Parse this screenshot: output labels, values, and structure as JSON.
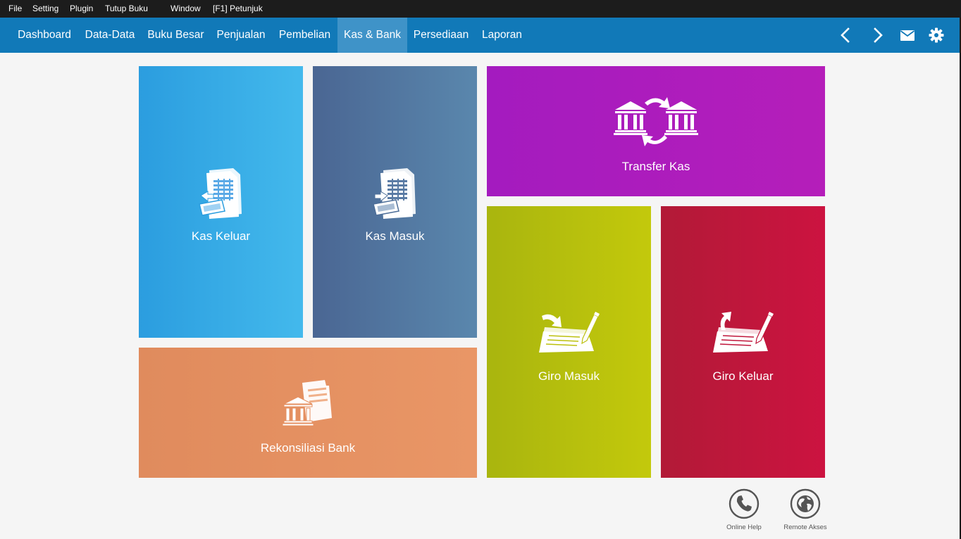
{
  "menubar": {
    "items": [
      "File",
      "Setting",
      "Plugin",
      "Tutup Buku",
      "Window",
      "[F1] Petunjuk"
    ]
  },
  "nav": {
    "tabs": [
      "Dashboard",
      "Data-Data",
      "Buku Besar",
      "Penjualan",
      "Pembelian",
      "Kas & Bank",
      "Persediaan",
      "Laporan"
    ],
    "active_tab": "Kas & Bank",
    "icons": [
      "chevron-left-icon",
      "chevron-right-icon",
      "envelope-icon",
      "gear-icon"
    ]
  },
  "tiles": {
    "kas_keluar": {
      "label": "Kas Keluar",
      "icon": "cash-out-document-icon",
      "color": "#2b9ddf"
    },
    "kas_masuk": {
      "label": "Kas Masuk",
      "icon": "cash-in-document-icon",
      "color": "#4a6693"
    },
    "transfer_kas": {
      "label": "Transfer Kas",
      "icon": "bank-transfer-icon",
      "color": "#b01dbd"
    },
    "giro_masuk": {
      "label": "Giro Masuk",
      "icon": "cheque-in-icon",
      "color": "#b8c00d"
    },
    "giro_keluar": {
      "label": "Giro Keluar",
      "icon": "cheque-out-icon",
      "color": "#c0173c"
    },
    "rekonsiliasi_bank": {
      "label": "Rekonsiliasi Bank",
      "icon": "bank-reconcile-icon",
      "color": "#e58f60"
    }
  },
  "help": {
    "online_help": {
      "label": "Online Help",
      "icon": "phone-icon"
    },
    "remote_akses": {
      "label": "Remote Akses",
      "icon": "globe-icon"
    }
  },
  "colors": {
    "navbar": "#1179b8",
    "navbar_active": "#3f93c8",
    "menubar": "#1c1c1c",
    "background": "#f5f5f5"
  }
}
